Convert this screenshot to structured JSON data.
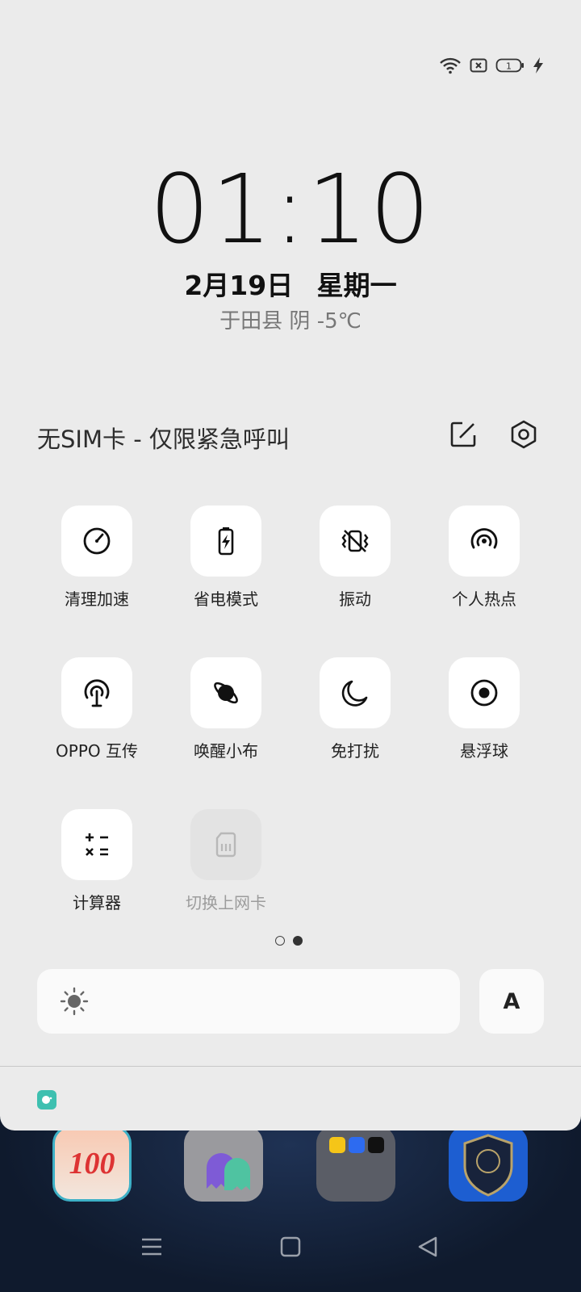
{
  "status_bar": {
    "icons": [
      "wifi-icon",
      "no-sim-icon",
      "battery-icon",
      "charging-icon"
    ],
    "battery_level": "1"
  },
  "lockscreen": {
    "time": "01:10",
    "date": "2月19日 星期一",
    "weather": "于田县 阴 -5℃"
  },
  "panel": {
    "sim_status": "无SIM卡 - 仅限紧急呼叫",
    "tiles": [
      {
        "label": "清理加速",
        "icon": "speedometer-icon",
        "enabled": true
      },
      {
        "label": "省电模式",
        "icon": "battery-saver-icon",
        "enabled": true
      },
      {
        "label": "振动",
        "icon": "vibrate-off-icon",
        "enabled": true
      },
      {
        "label": "个人热点",
        "icon": "hotspot-icon",
        "enabled": true
      },
      {
        "label": "OPPO 互传",
        "icon": "share-antenna-icon",
        "enabled": true
      },
      {
        "label": "唤醒小布",
        "icon": "planet-icon",
        "enabled": true
      },
      {
        "label": "免打扰",
        "icon": "moon-icon",
        "enabled": true
      },
      {
        "label": "悬浮球",
        "icon": "floating-ball-icon",
        "enabled": true
      },
      {
        "label": "计算器",
        "icon": "calculator-icon",
        "enabled": true
      },
      {
        "label": "切换上网卡",
        "icon": "sim-card-icon",
        "enabled": false
      }
    ],
    "page_indicator": {
      "current": 2,
      "total": 2
    },
    "auto_brightness_label": "A"
  },
  "home": {
    "app_1_text": "100"
  },
  "colors": {
    "panel_bg": "#ebebeb",
    "tile_bg": "#ffffff",
    "accent": "#3ec0b0"
  }
}
